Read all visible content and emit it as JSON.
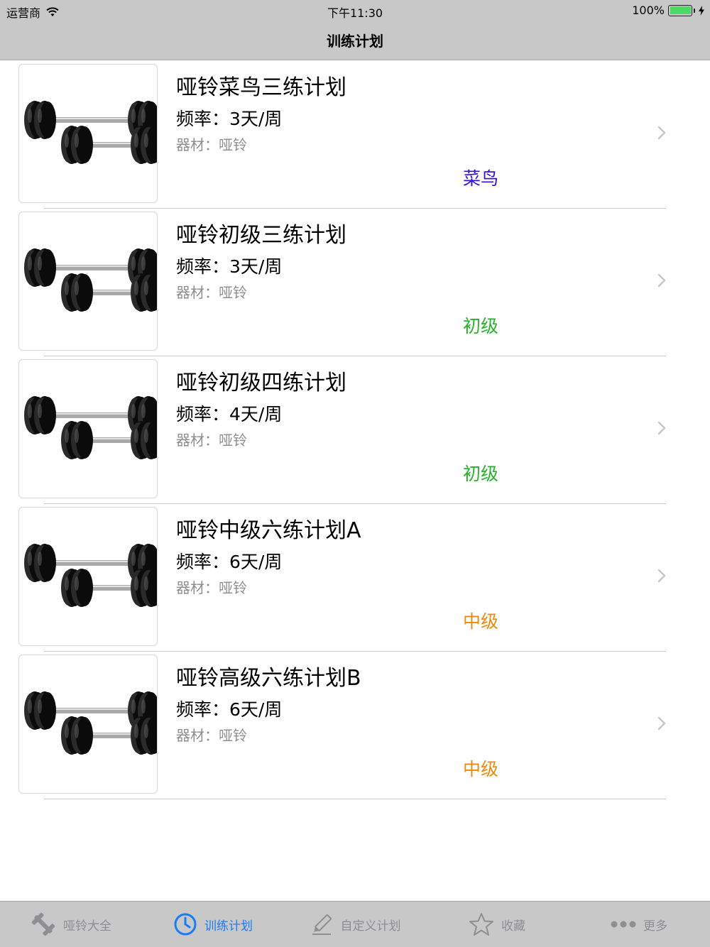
{
  "status_bar": {
    "carrier": "运营商",
    "time": "下午11:30",
    "battery": "100%"
  },
  "nav": {
    "title": "训练计划"
  },
  "plans": [
    {
      "name": "哑铃菜鸟三练计划",
      "frequency": "频率：3天/周",
      "equipment": "器材：哑铃",
      "level": "菜鸟",
      "level_color": "#3411d9"
    },
    {
      "name": "哑铃初级三练计划",
      "frequency": "频率：3天/周",
      "equipment": "器材：哑铃",
      "level": "初级",
      "level_color": "#27b32a"
    },
    {
      "name": "哑铃初级四练计划",
      "frequency": "频率：4天/周",
      "equipment": "器材：哑铃",
      "level": "初级",
      "level_color": "#27b32a"
    },
    {
      "name": "哑铃中级六练计划A",
      "frequency": "频率：6天/周",
      "equipment": "器材：哑铃",
      "level": "中级",
      "level_color": "#f08a0c"
    },
    {
      "name": "哑铃高级六练计划B",
      "frequency": "频率：6天/周",
      "equipment": "器材：哑铃",
      "level": "中级",
      "level_color": "#f08a0c"
    }
  ],
  "tabs": [
    {
      "label": "哑铃大全",
      "icon": "dumbbell-icon"
    },
    {
      "label": "训练计划",
      "icon": "clock-icon",
      "active": true
    },
    {
      "label": "自定义计划",
      "icon": "pencil-icon"
    },
    {
      "label": "收藏",
      "icon": "star-icon"
    },
    {
      "label": "更多",
      "icon": "more-icon"
    }
  ],
  "colors": {
    "bars": "#c8c8c8",
    "active_tab": "#1a7cf5",
    "inactive_tab": "#8e8e93"
  }
}
